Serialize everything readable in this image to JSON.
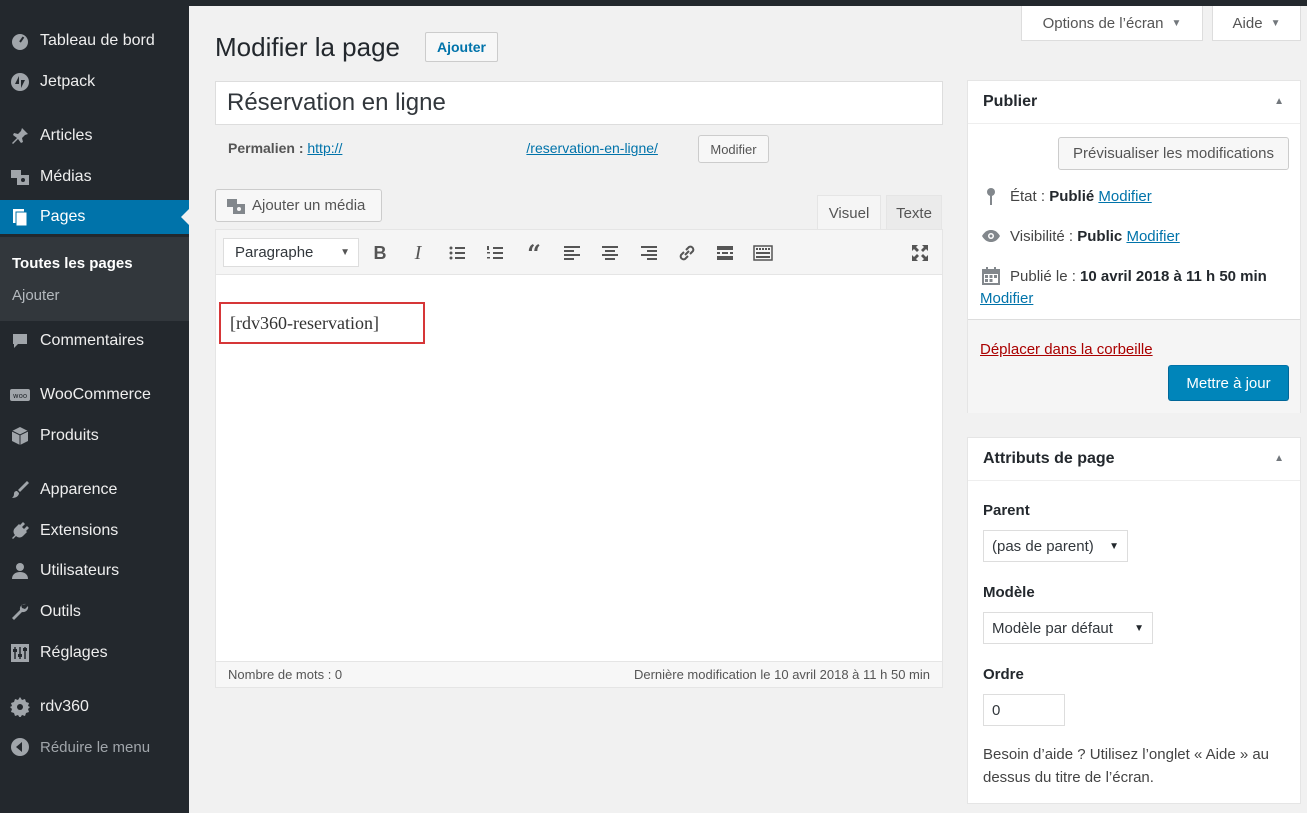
{
  "sidebar": {
    "items": [
      {
        "label": "Tableau de bord",
        "icon": "dashboard-icon"
      },
      {
        "label": "Jetpack",
        "icon": "jetpack-icon"
      },
      {
        "label": "Articles",
        "icon": "pin-icon"
      },
      {
        "label": "Médias",
        "icon": "media-icon"
      },
      {
        "label": "Pages",
        "icon": "pages-icon"
      },
      {
        "label": "Commentaires",
        "icon": "comment-icon"
      },
      {
        "label": "WooCommerce",
        "icon": "woocommerce-icon"
      },
      {
        "label": "Produits",
        "icon": "box-icon"
      },
      {
        "label": "Apparence",
        "icon": "brush-icon"
      },
      {
        "label": "Extensions",
        "icon": "plugin-icon"
      },
      {
        "label": "Utilisateurs",
        "icon": "user-icon"
      },
      {
        "label": "Outils",
        "icon": "wrench-icon"
      },
      {
        "label": "Réglages",
        "icon": "settings-icon"
      },
      {
        "label": "rdv360",
        "icon": "gear-icon"
      }
    ],
    "submenu": [
      "Toutes les pages",
      "Ajouter"
    ],
    "collapse": "Réduire le menu"
  },
  "screen_meta": {
    "options": "Options de l’écran",
    "help": "Aide"
  },
  "header": {
    "title": "Modifier la page",
    "add_new": "Ajouter"
  },
  "post": {
    "title": "Réservation en ligne",
    "permalink_label": "Permalien :",
    "permalink_base": "http://",
    "permalink_slug": "/reservation-en-ligne/",
    "permalink_edit": "Modifier"
  },
  "editor": {
    "add_media": "Ajouter un média",
    "tab_visual": "Visuel",
    "tab_text": "Texte",
    "format": "Paragraphe",
    "content": "[rdv360-reservation]",
    "word_count": "Nombre de mots : 0",
    "last_modified": "Dernière modification le 10 avril 2018 à 11 h 50 min"
  },
  "publish": {
    "title": "Publier",
    "preview": "Prévisualiser les modifications",
    "status_label": "État :",
    "status_value": "Publié",
    "visibility_label": "Visibilité :",
    "visibility_value": "Public",
    "published_label": "Publié le :",
    "published_value": "10 avril 2018 à 11 h 50 min",
    "edit": "Modifier",
    "trash": "Déplacer dans la corbeille",
    "update": "Mettre à jour"
  },
  "attributes": {
    "title": "Attributs de page",
    "parent_label": "Parent",
    "parent_value": "(pas de parent)",
    "template_label": "Modèle",
    "template_value": "Modèle par défaut",
    "order_label": "Ordre",
    "order_value": "0",
    "help": "Besoin d’aide ? Utilisez l’onglet « Aide » au dessus du titre de l’écran."
  },
  "colors": {
    "accent": "#0073aa",
    "sidebar": "#23282d",
    "primary_button": "#0085ba",
    "highlight_border": "#d63638"
  }
}
